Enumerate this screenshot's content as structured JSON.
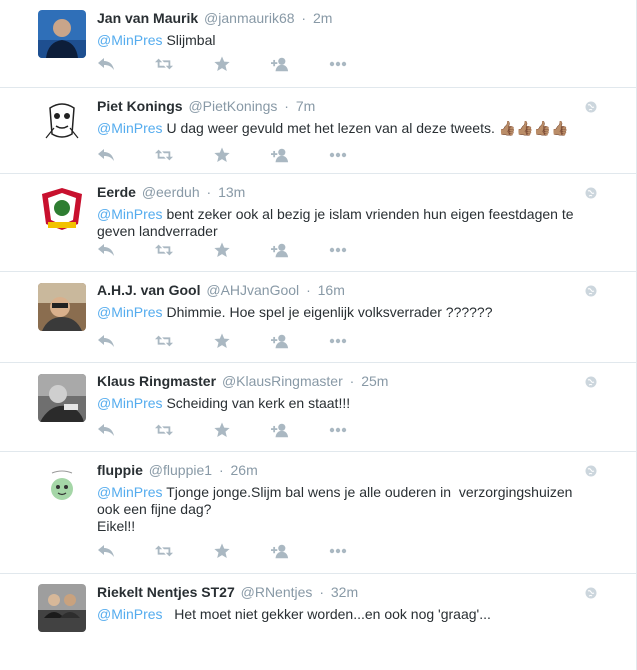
{
  "colors": {
    "accent": "#55acee",
    "muted": "#8899a6",
    "action": "#aab8c2",
    "text": "#292f33"
  },
  "icons": [
    "reply-icon",
    "retweet-icon",
    "favorite-icon",
    "follow-icon",
    "more-icon",
    "globe-icon"
  ],
  "tweets": [
    {
      "fullname": "Jan van Maurik",
      "username": "@janmaurik68",
      "sep": "·",
      "time": "2m",
      "mention": "@MinPres",
      "body": " Slijmbal",
      "globe": false
    },
    {
      "fullname": "Piet Konings",
      "username": "@PietKonings",
      "sep": "·",
      "time": "7m",
      "mention": "@MinPres",
      "body": " U dag weer gevuld met het lezen van al deze tweets. 👍🏽👍🏽👍🏽👍🏽",
      "globe": true
    },
    {
      "fullname": "Eerde",
      "username": "@eerduh",
      "sep": "·",
      "time": "13m",
      "mention": "@MinPres",
      "body": " bent zeker ook al bezig je islam vrienden hun eigen feestdagen te geven landverrader",
      "globe": true
    },
    {
      "fullname": "A.H.J. van Gool",
      "username": "@AHJvanGool",
      "sep": "·",
      "time": "16m",
      "mention": "@MinPres",
      "body": " Dhimmie. Hoe spel je eigenlijk volksverrader ??????",
      "globe": true
    },
    {
      "fullname": "Klaus Ringmaster",
      "username": "@KlausRingmaster",
      "sep": "·",
      "time": "25m",
      "mention": "@MinPres",
      "body": " Scheiding van kerk en staat!!!",
      "globe": true
    },
    {
      "fullname": "fluppie",
      "username": "@fluppie1",
      "sep": "·",
      "time": "26m",
      "mention": "@MinPres",
      "body": " Tjonge jonge.Slijm bal wens je alle ouderen in  verzorgingshuizen ook een fijne dag?\nEikel!!",
      "globe": true
    },
    {
      "fullname": "Riekelt Nentjes ST27",
      "username": "@RNentjes",
      "sep": "·",
      "time": "32m",
      "mention": "@MinPres",
      "body": "   Het moet niet gekker worden...en ook nog 'graag'...",
      "globe": true
    }
  ]
}
